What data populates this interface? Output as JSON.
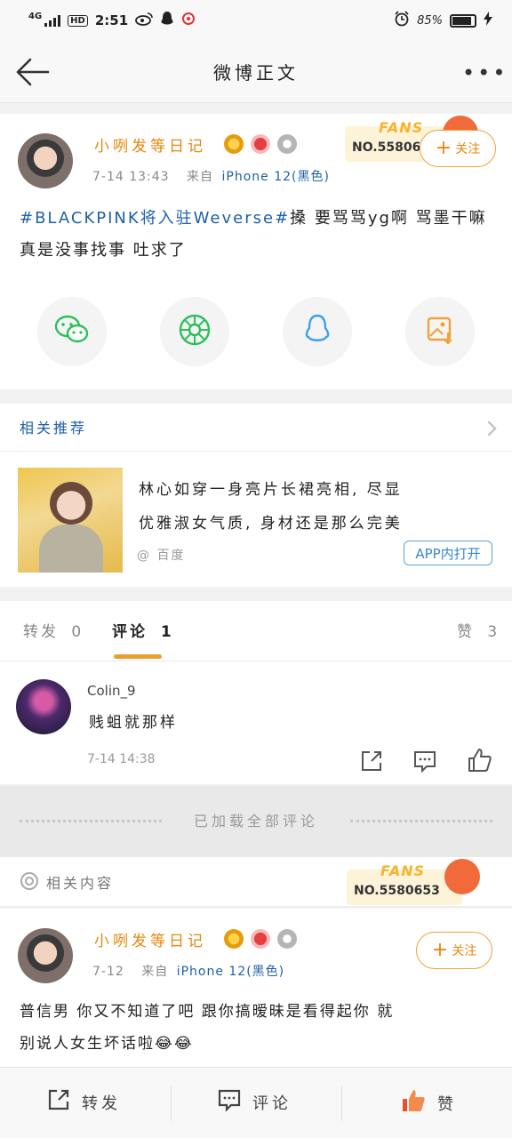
{
  "status_bar": {
    "network": "4G",
    "hd": "HD",
    "time": "2:51",
    "battery": "85%",
    "icons": [
      "signal-icon",
      "hd-icon",
      "weibo-icon",
      "qq-icon",
      "app-icon",
      "alarm-icon",
      "battery-icon",
      "charging-icon"
    ]
  },
  "nav": {
    "title": "微博正文",
    "back_icon": "back-arrow-icon",
    "more_icon": "more-dots-icon",
    "more_label": "•••"
  },
  "post": {
    "username": "小咧发等日记",
    "time": "7-14 13:43",
    "source_prefix": "来自",
    "source": "iPhone 12(黑色)",
    "hashtag": "#BLACKPINK将入驻Weverse#",
    "text_line1": "搡 要骂骂yg啊 骂墨干嘛",
    "text_line2": "真是没事找事 吐求了",
    "follow_label": "关注",
    "fans_label": "FANS",
    "fans_no": "NO.558065"
  },
  "share_icons": [
    "wechat-icon",
    "moments-icon",
    "qq-icon",
    "save-image-icon"
  ],
  "related_recommend": {
    "label": "相关推荐",
    "title_line1": "林心如穿一身亮片长裙亮相, 尽显",
    "title_line2": "优雅淑女气质, 身材还是那么完美",
    "source": "@ 百度",
    "app_open": "APP内打开"
  },
  "tabs": {
    "repost_label": "转发",
    "repost_count": "0",
    "comment_label": "评论",
    "comment_count": "1",
    "like_label": "赞",
    "like_count": "3"
  },
  "comment": {
    "name": "Colin_9",
    "text": "贱蛆就那样",
    "time": "7-14 14:38"
  },
  "loaded_all": "已加载全部评论",
  "related_content": {
    "label": "相关内容",
    "fans_label": "FANS",
    "fans_no": "NO.5580653"
  },
  "post2": {
    "username": "小咧发等日记",
    "time": "7-12",
    "source_prefix": "来自",
    "source": "iPhone 12(黑色)",
    "follow_label": "关注",
    "text_line1": "普信男 你又不知道了吧 跟你搞暧昧是看得起你 就",
    "text_line2": "别说人女生坏话啦😂😂"
  },
  "bottom_bar": {
    "repost": "转发",
    "comment": "评论",
    "like": "赞"
  },
  "colors": {
    "accent_orange": "#e8860c",
    "link_blue": "#1f5fa8",
    "like_red": "#e8502b"
  }
}
